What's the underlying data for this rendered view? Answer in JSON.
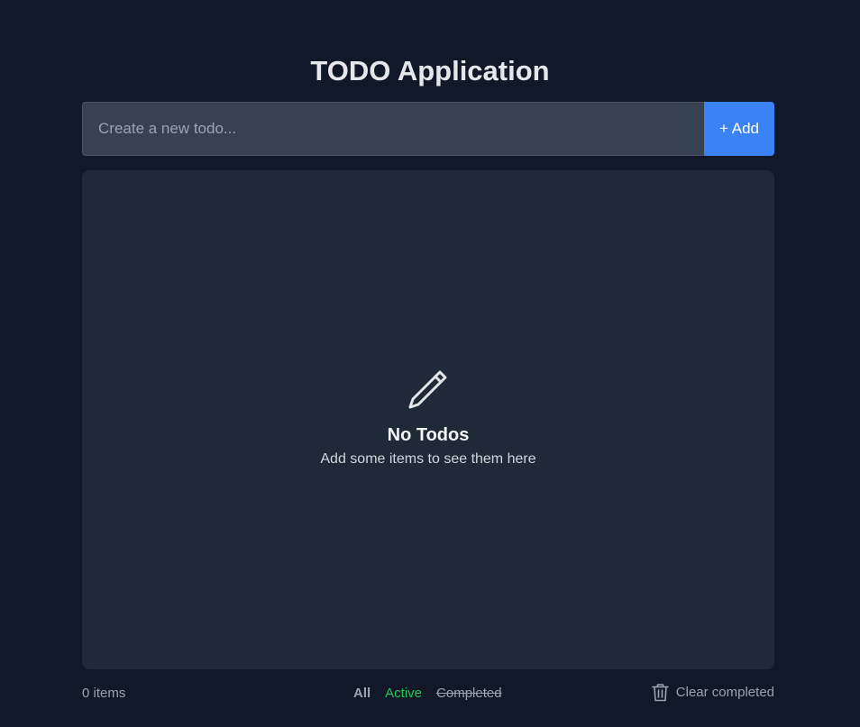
{
  "header": {
    "title": "TODO Application"
  },
  "new_todo": {
    "placeholder": "Create a new todo...",
    "value": "",
    "add_label": "+ Add"
  },
  "empty_state": {
    "icon": "pencil-icon",
    "title": "No Todos",
    "subtitle": "Add some items to see them here"
  },
  "footer": {
    "item_count": "0 items",
    "filters": [
      {
        "label": "All",
        "state": "selected"
      },
      {
        "label": "Active",
        "state": "normal"
      },
      {
        "label": "Completed",
        "state": "normal"
      }
    ],
    "clear_label": "Clear completed",
    "clear_icon": "trash-icon"
  },
  "colors": {
    "background": "#111827",
    "panel": "#1f2937",
    "input_bg": "#374151",
    "accent": "#3b82f6",
    "active_filter": "#22c55e",
    "muted_text": "#9ca3af"
  }
}
